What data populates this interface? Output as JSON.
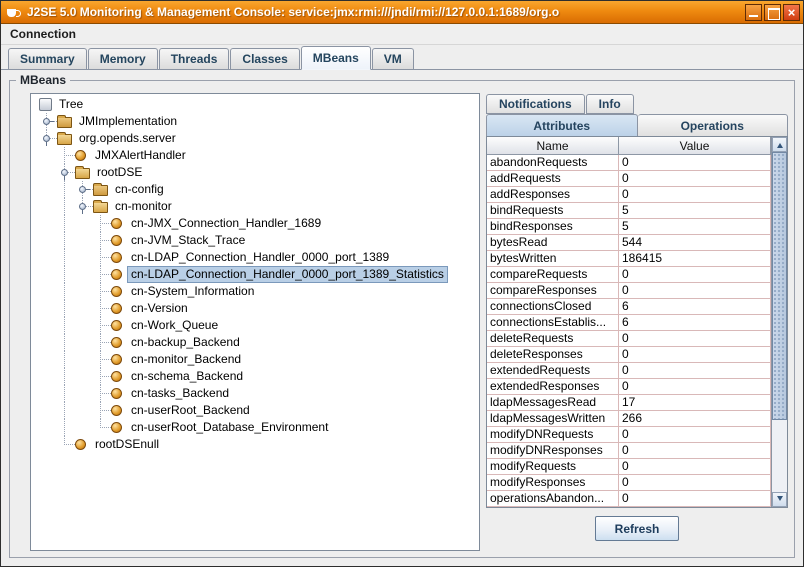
{
  "window": {
    "title": "J2SE 5.0 Monitoring & Management Console: service:jmx:rmi:///jndi/rmi://127.0.0.1:1689/org.o",
    "controls": [
      "minimize",
      "maximize",
      "close"
    ]
  },
  "menubar": {
    "items": [
      {
        "label": "Connection"
      }
    ]
  },
  "main_tabs": {
    "items": [
      {
        "label": "Summary"
      },
      {
        "label": "Memory"
      },
      {
        "label": "Threads"
      },
      {
        "label": "Classes"
      },
      {
        "label": "MBeans",
        "selected": true
      },
      {
        "label": "VM"
      }
    ]
  },
  "mbeans_panel": {
    "title": "MBeans"
  },
  "tree": {
    "nodes": [
      {
        "label": "Tree",
        "level": 0,
        "icon": "root",
        "handle": null
      },
      {
        "label": "JMImplementation",
        "level": 1,
        "icon": "folder",
        "handle": "collapsed"
      },
      {
        "label": "org.opends.server",
        "level": 1,
        "icon": "folder-open",
        "handle": "expanded"
      },
      {
        "label": "JMXAlertHandler",
        "level": 2,
        "icon": "bean",
        "handle": null
      },
      {
        "label": "rootDSE",
        "level": 2,
        "icon": "folder-open",
        "handle": "expanded"
      },
      {
        "label": "cn-config",
        "level": 3,
        "icon": "folder",
        "handle": "collapsed"
      },
      {
        "label": "cn-monitor",
        "level": 3,
        "icon": "folder-open",
        "handle": "expanded"
      },
      {
        "label": "cn-JMX_Connection_Handler_1689",
        "level": 4,
        "icon": "bean",
        "handle": null
      },
      {
        "label": "cn-JVM_Stack_Trace",
        "level": 4,
        "icon": "bean",
        "handle": null
      },
      {
        "label": "cn-LDAP_Connection_Handler_0000_port_1389",
        "level": 4,
        "icon": "bean",
        "handle": null
      },
      {
        "label": "cn-LDAP_Connection_Handler_0000_port_1389_Statistics",
        "level": 4,
        "icon": "bean",
        "handle": null,
        "selected": true
      },
      {
        "label": "cn-System_Information",
        "level": 4,
        "icon": "bean",
        "handle": null
      },
      {
        "label": "cn-Version",
        "level": 4,
        "icon": "bean",
        "handle": null
      },
      {
        "label": "cn-Work_Queue",
        "level": 4,
        "icon": "bean",
        "handle": null
      },
      {
        "label": "cn-backup_Backend",
        "level": 4,
        "icon": "bean",
        "handle": null
      },
      {
        "label": "cn-monitor_Backend",
        "level": 4,
        "icon": "bean",
        "handle": null
      },
      {
        "label": "cn-schema_Backend",
        "level": 4,
        "icon": "bean",
        "handle": null
      },
      {
        "label": "cn-tasks_Backend",
        "level": 4,
        "icon": "bean",
        "handle": null
      },
      {
        "label": "cn-userRoot_Backend",
        "level": 4,
        "icon": "bean",
        "handle": null
      },
      {
        "label": "cn-userRoot_Database_Environment",
        "level": 4,
        "icon": "bean",
        "handle": null
      },
      {
        "label": "rootDSEnull",
        "level": 2,
        "icon": "bean",
        "handle": null
      }
    ]
  },
  "detail_tabs": {
    "rows": [
      [
        {
          "label": "Notifications"
        },
        {
          "label": "Info"
        }
      ],
      [
        {
          "label": "Attributes",
          "selected": true
        },
        {
          "label": "Operations"
        }
      ]
    ]
  },
  "attributes_table": {
    "columns": [
      "Name",
      "Value"
    ],
    "rows": [
      {
        "name": "abandonRequests",
        "value": "0"
      },
      {
        "name": "addRequests",
        "value": "0"
      },
      {
        "name": "addResponses",
        "value": "0"
      },
      {
        "name": "bindRequests",
        "value": "5"
      },
      {
        "name": "bindResponses",
        "value": "5"
      },
      {
        "name": "bytesRead",
        "value": "544"
      },
      {
        "name": "bytesWritten",
        "value": "186415"
      },
      {
        "name": "compareRequests",
        "value": "0"
      },
      {
        "name": "compareResponses",
        "value": "0"
      },
      {
        "name": "connectionsClosed",
        "value": "6"
      },
      {
        "name": "connectionsEstablis...",
        "value": "6"
      },
      {
        "name": "deleteRequests",
        "value": "0"
      },
      {
        "name": "deleteResponses",
        "value": "0"
      },
      {
        "name": "extendedRequests",
        "value": "0"
      },
      {
        "name": "extendedResponses",
        "value": "0"
      },
      {
        "name": "ldapMessagesRead",
        "value": "17"
      },
      {
        "name": "ldapMessagesWritten",
        "value": "266"
      },
      {
        "name": "modifyDNRequests",
        "value": "0"
      },
      {
        "name": "modifyDNResponses",
        "value": "0"
      },
      {
        "name": "modifyRequests",
        "value": "0"
      },
      {
        "name": "modifyResponses",
        "value": "0"
      },
      {
        "name": "operationsAbandon...",
        "value": "0"
      }
    ]
  },
  "refresh_button": {
    "label": "Refresh"
  },
  "colors": {
    "titlebar_orange": "#ef8a10",
    "selection_blue": "#b9cfe6",
    "tab_text_navy": "#24455e",
    "table_grid_pink": "#d9b8b8",
    "selected_tab_blue": "#bcd2e8"
  }
}
